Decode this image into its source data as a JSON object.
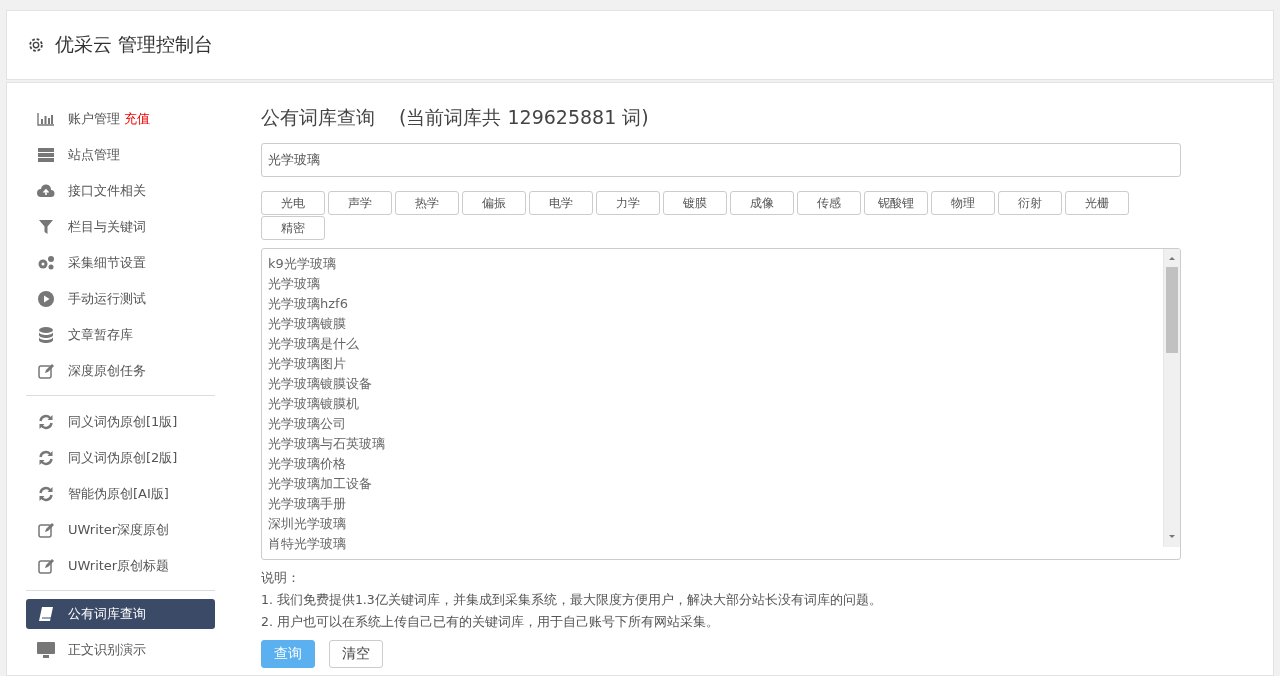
{
  "header": {
    "title": "优采云 管理控制台"
  },
  "sidebar": {
    "groups": [
      [
        {
          "label": "账户管理",
          "badge": "充值",
          "selected": false
        },
        {
          "label": "站点管理",
          "selected": false
        },
        {
          "label": "接口文件相关",
          "selected": false
        },
        {
          "label": "栏目与关键词",
          "selected": false
        },
        {
          "label": "采集细节设置",
          "selected": false
        },
        {
          "label": "手动运行测试",
          "selected": false
        },
        {
          "label": "文章暂存库",
          "selected": false
        },
        {
          "label": "深度原创任务",
          "selected": false
        }
      ],
      [
        {
          "label": "同义词伪原创[1版]",
          "selected": false
        },
        {
          "label": "同义词伪原创[2版]",
          "selected": false
        },
        {
          "label": "智能伪原创[AI版]",
          "selected": false
        },
        {
          "label": "UWriter深度原创",
          "selected": false
        },
        {
          "label": "UWriter原创标题",
          "selected": false
        }
      ],
      [
        {
          "label": "公有词库查询",
          "selected": true
        },
        {
          "label": "正文识别演示",
          "selected": false
        }
      ]
    ]
  },
  "main": {
    "title": "公有词库查询",
    "count_note": "(当前词库共 129625881 词)",
    "search": {
      "value": "光学玻璃"
    },
    "tags": [
      "光电",
      "声学",
      "热学",
      "偏振",
      "电学",
      "力学",
      "镀膜",
      "成像",
      "传感",
      "铌酸锂",
      "物理",
      "衍射",
      "光栅",
      "精密"
    ],
    "results": [
      "k9光学玻璃",
      "光学玻璃",
      "光学玻璃hzf6",
      "光学玻璃镀膜",
      "光学玻璃是什么",
      "光学玻璃图片",
      "光学玻璃镀膜设备",
      "光学玻璃镀膜机",
      "光学玻璃公司",
      "光学玻璃与石英玻璃",
      "光学玻璃价格",
      "光学玻璃加工设备",
      "光学玻璃手册",
      "深圳光学玻璃",
      "肖特光学玻璃"
    ],
    "notes_title": "说明：",
    "notes": [
      "1. 我们免费提供1.3亿关键词库，并集成到采集系统，最大限度方便用户，解决大部分站长没有词库的问题。",
      "2. 用户也可以在系统上传自己已有的关键词库，用于自己账号下所有网站采集。"
    ],
    "buttons": [
      {
        "label": "查询",
        "kind": "primary"
      },
      {
        "label": "清空",
        "kind": "default"
      }
    ]
  }
}
